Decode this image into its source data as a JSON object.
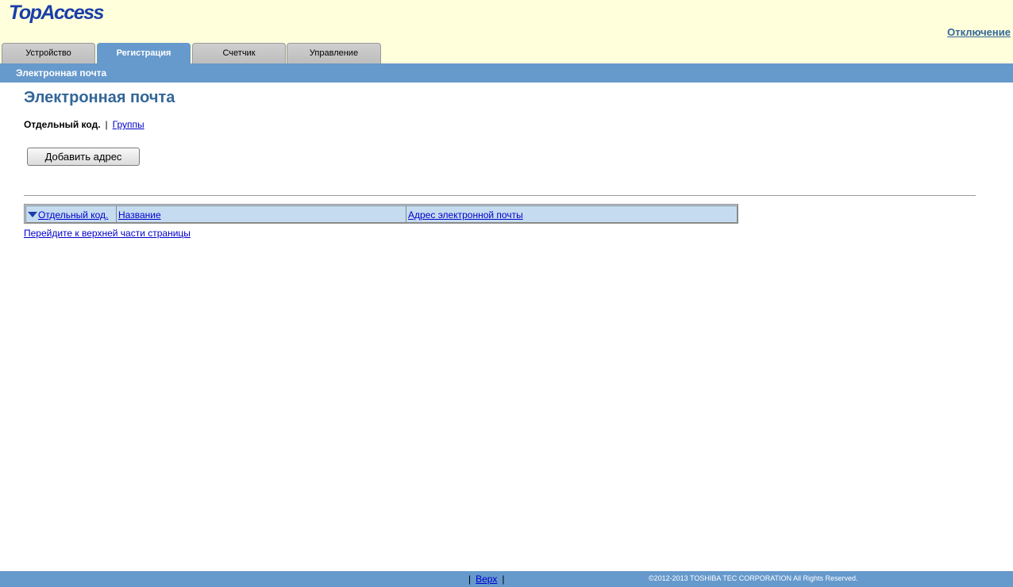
{
  "header": {
    "logo_text": "TopAccess",
    "logout_label": "Отключение"
  },
  "tabs": [
    {
      "label": "Устройство"
    },
    {
      "label": "Регистрация"
    },
    {
      "label": "Счетчик"
    },
    {
      "label": "Управление"
    }
  ],
  "subbar": {
    "label": "Электронная почта"
  },
  "main": {
    "title": "Электронная почта",
    "subnav": {
      "current": "Отдельный код.",
      "separator": "|",
      "link": "Группы"
    },
    "add_button_label": "Добавить адрес",
    "table": {
      "columns": [
        {
          "label": "Отдельный код."
        },
        {
          "label": "Название"
        },
        {
          "label": "Адрес электронной почты"
        }
      ]
    },
    "top_link": "Перейдите к верхней части страницы"
  },
  "footer": {
    "sep": "|",
    "top_label": "Верх",
    "copyright": "©2012-2013 TOSHIBA TEC CORPORATION All Rights Reserved."
  },
  "colors": {
    "header_bg": "#ffffdc",
    "accent": "#6699cc",
    "title": "#336699",
    "table_header_bg": "#c5dcf0",
    "link": "#0000cc"
  }
}
